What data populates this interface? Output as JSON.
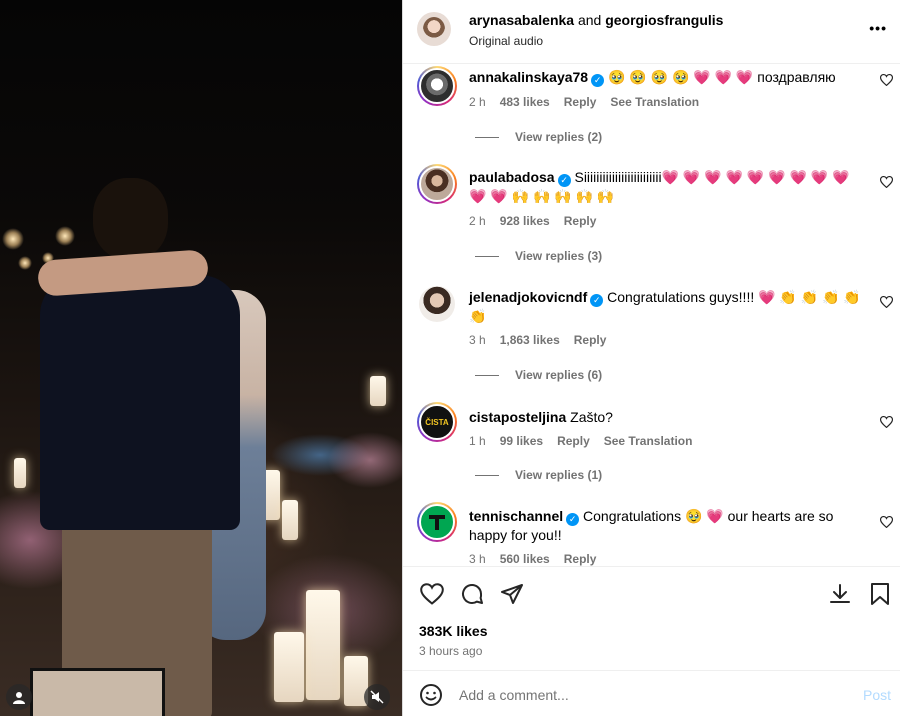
{
  "post": {
    "author1": "arynasabalenka",
    "and_text": "and",
    "author2": "georgiosfrangulis",
    "audio": "Original audio",
    "more": "•••"
  },
  "comments": [
    {
      "user": "annakalinskaya78",
      "verified": true,
      "text": "🥹 🥹 🥹 🥹 💗 💗 💗 поздравляю",
      "time": "2 h",
      "likes": "483 likes",
      "reply": "Reply",
      "translate": "See Translation",
      "view_replies": "View replies (2)"
    },
    {
      "user": "paulabadosa",
      "verified": true,
      "text": "Siiiiiiiiiiiiiiiiiiiiiiiii💗 💗 💗 💗 💗 💗 💗 💗 💗 💗 💗 🙌 🙌 🙌 🙌 🙌",
      "time": "2 h",
      "likes": "928 likes",
      "reply": "Reply",
      "view_replies": "View replies (3)"
    },
    {
      "user": "jelenadjokovicndf",
      "verified": true,
      "text": "Congratulations guys!!!! 💗 👏 👏 👏 👏 👏",
      "time": "3 h",
      "likes": "1,863 likes",
      "reply": "Reply",
      "view_replies": "View replies (6)"
    },
    {
      "user": "cistaposteljina",
      "verified": false,
      "text": "Zašto?",
      "time": "1 h",
      "likes": "99 likes",
      "reply": "Reply",
      "translate": "See Translation",
      "view_replies": "View replies (1)",
      "avatar_text": "ČISTA"
    },
    {
      "user": "tennischannel",
      "verified": true,
      "text": "Congratulations 🥹 💗 our hearts are so happy for you!!",
      "time": "3 h",
      "likes": "560 likes",
      "reply": "Reply"
    }
  ],
  "actions": {
    "likes": "383K likes",
    "time_ago": "3 hours ago"
  },
  "add_comment": {
    "placeholder": "Add a comment...",
    "post_label": "Post"
  },
  "icons": [
    "heart-icon",
    "comment-icon",
    "share-icon",
    "download-icon",
    "bookmark-icon",
    "emoji-icon",
    "mute-icon",
    "user-icon"
  ],
  "colors": {
    "link_blue": "#0095f6",
    "muted": "#737373",
    "verified": "#0095f6"
  }
}
